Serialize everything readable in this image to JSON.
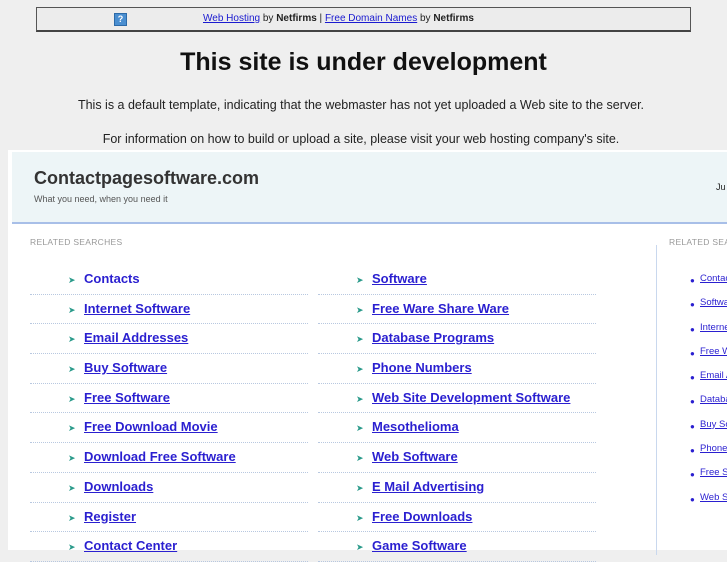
{
  "topbar": {
    "help_icon": "question-icon",
    "link1": "Web Hosting",
    "by1": " by ",
    "brand1": "Netfirms",
    "sep": " | ",
    "link2": "Free Domain Names",
    "by2": " by ",
    "brand2": "Netfirms"
  },
  "title": "This site is under development",
  "para1": "This is a default template, indicating that the webmaster has not yet uploaded a Web site to the server.",
  "para2": "For information on how to build or upload a site, please visit your web hosting company's site.",
  "site": {
    "name": "Contactpagesoftware.com",
    "tagline": "What you need, when you need it",
    "right_text": "Ju"
  },
  "main": {
    "label": "RELATED SEARCHES",
    "left": [
      "Contacts",
      "Internet Software",
      "Email Addresses",
      "Buy Software",
      "Free Software",
      "Free Download Movie",
      "Download Free Software",
      "Downloads",
      "Register",
      "Contact Center"
    ],
    "right": [
      "Software",
      "Free Ware Share Ware",
      "Database Programs",
      "Phone Numbers",
      "Web Site Development Software",
      "Mesothelioma",
      "Web Software",
      "E Mail Advertising",
      "Free Downloads",
      "Game Software"
    ]
  },
  "sidebar": {
    "label": "RELATED SEARCHES",
    "items": [
      "Contacts",
      "Software",
      "Internet Software",
      "Free Ware Share Ware",
      "Email Addresses",
      "Database Programs",
      "Buy Software",
      "Phone Numbers",
      "Free Software",
      "Web Site Development Software"
    ]
  }
}
